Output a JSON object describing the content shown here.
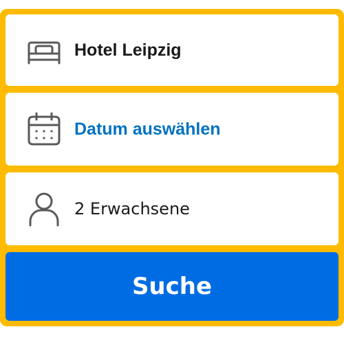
{
  "destination": {
    "value": "Hotel Leipzig",
    "icon": "bed-icon"
  },
  "dates": {
    "placeholder": "Datum auswählen",
    "icon": "calendar-icon",
    "color": "#0071c2"
  },
  "guests": {
    "value": "2 Erwachsene",
    "icon": "person-icon"
  },
  "search_button": {
    "label": "Suche",
    "color": "#006ce4"
  },
  "theme": {
    "border_color": "#febb02",
    "icon_color": "#595959"
  }
}
